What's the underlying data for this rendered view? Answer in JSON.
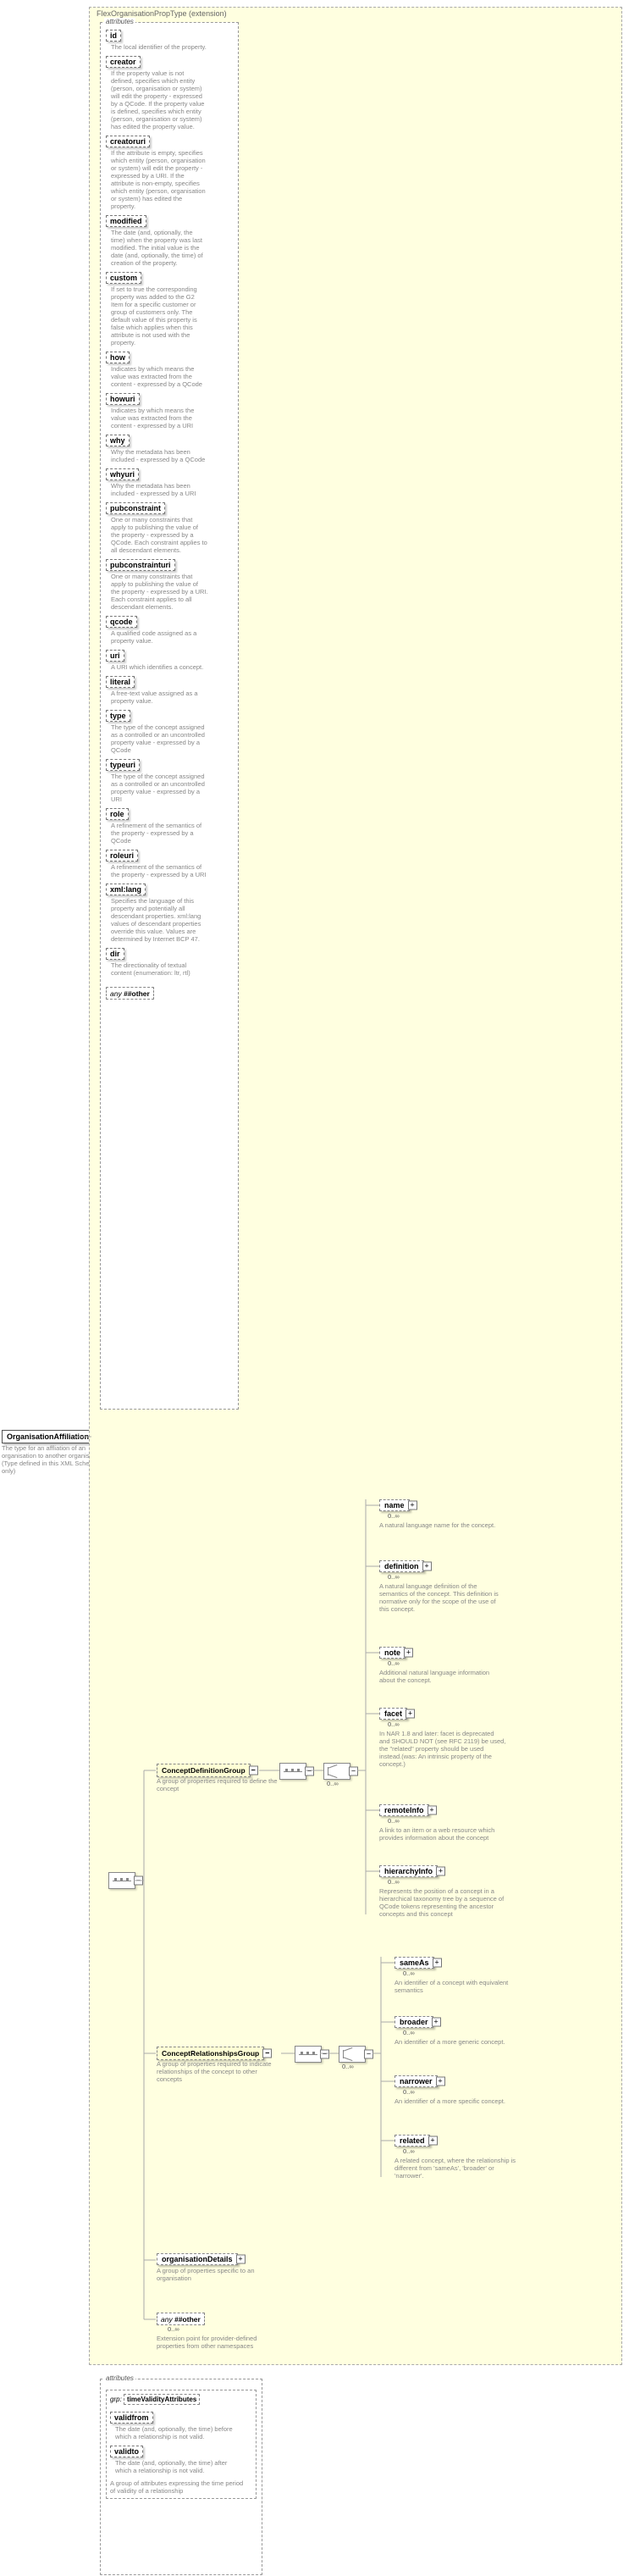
{
  "root": {
    "name": "OrganisationAffiliationType",
    "desc": "The type for an affliation of an organisation to another organisation (Type defined in this XML Schema only)"
  },
  "extension": {
    "label": "FlexOrganisationPropType (extension)"
  },
  "attrLabel": "attributes",
  "attrs1": [
    {
      "name": "id",
      "desc": "The local identifier of the property."
    },
    {
      "name": "creator",
      "desc": "If the property value is not defined, specifies which entity (person, organisation or system) will edit the property - expressed by a QCode. If the property value is defined, specifies which entity (person, organisation or system) has edited the property value."
    },
    {
      "name": "creatoruri",
      "desc": "If the attribute is empty, specifies which entity (person, organisation or system) will edit the property - expressed by a URI. If the attribute is non-empty, specifies which entity (person, organisation or system) has edited the property."
    },
    {
      "name": "modified",
      "desc": "The date (and, optionally, the time) when the property was last modified. The initial value is the date (and, optionally, the time) of creation of the property."
    },
    {
      "name": "custom",
      "desc": "If set to true the corresponding property was added to the G2 Item for a specific customer or group of customers only. The default value of this property is false which applies when this attribute is not used with the property."
    },
    {
      "name": "how",
      "desc": "Indicates by which means the value was extracted from the content - expressed by a QCode"
    },
    {
      "name": "howuri",
      "desc": "Indicates by which means the value was extracted from the content - expressed by a URI"
    },
    {
      "name": "why",
      "desc": "Why the metadata has been included - expressed by a QCode"
    },
    {
      "name": "whyuri",
      "desc": "Why the metadata has been included - expressed by a URI"
    },
    {
      "name": "pubconstraint",
      "desc": "One or many constraints that apply to publishing the value of the property - expressed by a QCode. Each constraint applies to all descendant elements."
    },
    {
      "name": "pubconstrainturi",
      "desc": "One or many constraints that apply to publishing the value of the property - expressed by a URI. Each constraint applies to all descendant elements."
    },
    {
      "name": "qcode",
      "desc": "A qualified code assigned as a property value."
    },
    {
      "name": "uri",
      "desc": "A URI which identifies a concept."
    },
    {
      "name": "literal",
      "desc": "A free-text value assigned as a property value."
    },
    {
      "name": "type",
      "desc": "The type of the concept assigned as a controlled or an uncontrolled property value - expressed by a QCode"
    },
    {
      "name": "typeuri",
      "desc": "The type of the concept assigned as a controlled or an uncontrolled property value - expressed by a URI"
    },
    {
      "name": "role",
      "desc": "A refinement of the semantics of the property - expressed by a QCode"
    },
    {
      "name": "roleuri",
      "desc": "A refinement of the semantics of the property - expressed by a URI"
    },
    {
      "name": "xml:lang",
      "desc": "Specifies the language of this property and potentially all descendant properties. xml:lang values of descendant properties override this value. Values are determined by Internet BCP 47."
    },
    {
      "name": "dir",
      "desc": "The directionality of textual content (enumeration: ltr, rtl)"
    }
  ],
  "anyAttr": {
    "prefix": "any",
    "ns": "##other"
  },
  "groups": {
    "cdg": {
      "name": "ConceptDefinitionGroup",
      "desc": "A group of properties required to define the concept"
    },
    "crg": {
      "name": "ConceptRelationshipsGroup",
      "desc": "A group of properties required to indicate relationships of the concept to other concepts"
    },
    "orgDetails": {
      "name": "organisationDetails",
      "desc": "A group of properties specific to an organisation"
    }
  },
  "anyOther": {
    "prefix": "any",
    "ns": "##other",
    "card": "0..∞",
    "desc": "Extension point for provider-defined properties from other namespaces"
  },
  "cdgItems": [
    {
      "name": "name",
      "desc": "A natural language name for the concept."
    },
    {
      "name": "definition",
      "desc": "A natural language definition of the semantics of the concept. This definition is normative only for the scope of the use of this concept."
    },
    {
      "name": "note",
      "desc": "Additional natural language information about the concept."
    },
    {
      "name": "facet",
      "desc": "In NAR 1.8 and later: facet is deprecated and SHOULD NOT (see RFC 2119) be used, the \"related\" property should be used instead.(was: An intrinsic property of the concept.)"
    },
    {
      "name": "remoteInfo",
      "desc": "A link to an item or a web resource which provides information about the concept"
    },
    {
      "name": "hierarchyInfo",
      "desc": "Represents the position of a concept in a hierarchical taxonomy tree by a sequence of QCode tokens representing the ancestor concepts and this concept"
    }
  ],
  "crgItems": [
    {
      "name": "sameAs",
      "desc": "An identifier of a concept with equivalent semantics"
    },
    {
      "name": "broader",
      "desc": "An identifier of a more generic concept."
    },
    {
      "name": "narrower",
      "desc": "An identifier of a more specific concept."
    },
    {
      "name": "related",
      "desc": "A related concept, where the relationship is different from 'sameAs', 'broader' or 'narrower'."
    }
  ],
  "card0inf": "0..∞",
  "validity": {
    "groupLabel": "grp:",
    "groupName": "timeValidityAttributes",
    "items": [
      {
        "name": "validfrom",
        "desc": "The date (and, optionally, the time) before which a relationship is not valid."
      },
      {
        "name": "validto",
        "desc": "The date (and, optionally, the time) after which a relationship is not valid."
      }
    ],
    "desc": "A group of attributes expressing the time period of validity of a relationship"
  }
}
